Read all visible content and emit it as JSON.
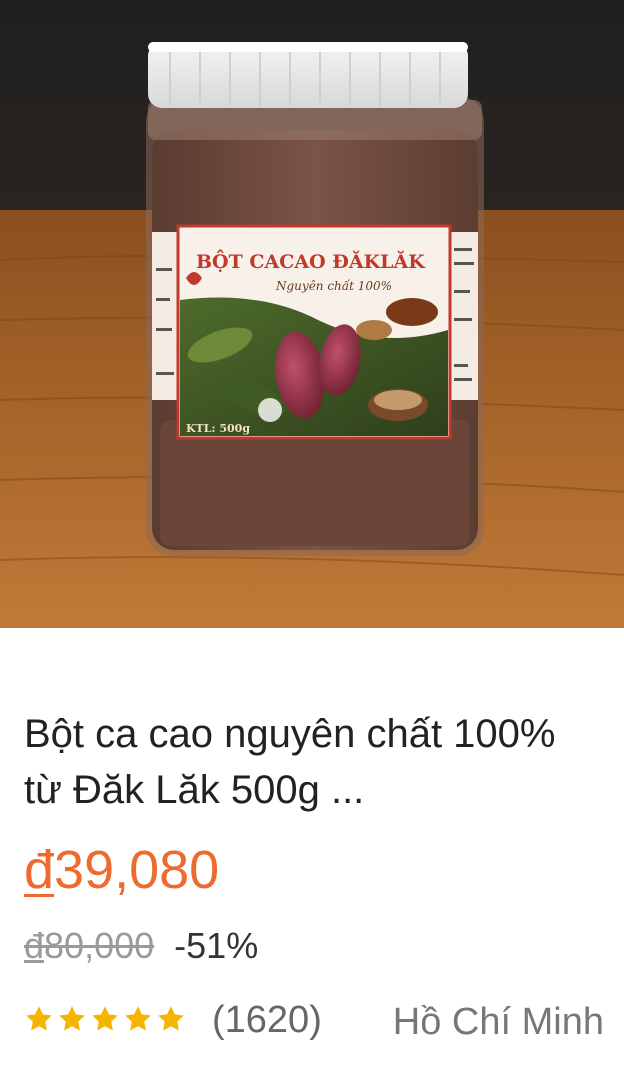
{
  "product": {
    "image": {
      "label_title": "BỘT CACAO ĐĂKLĂK",
      "label_subtitle": "Nguyên chất 100%",
      "label_weight": "KTL: 500g"
    },
    "title": "Bột ca cao nguyên chất 100% từ Đăk Lăk 500g ...",
    "price_currency": "đ",
    "price_value": "39,080",
    "original_currency": "đ",
    "original_value": "80,000",
    "discount": "-51%",
    "rating": {
      "stars": 5,
      "review_count": "(1620)",
      "star_color": "#f5b400"
    },
    "location": "Hồ Chí Minh",
    "accent_color": "#ee6a2e"
  }
}
